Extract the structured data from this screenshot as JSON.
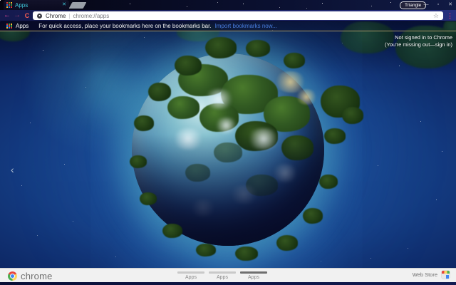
{
  "theme": {
    "accent_pink": "#ff4fa3",
    "gold_line": "#a89968",
    "toolbar_bg": "#1d2468",
    "frame_bg": "#0a0f2e",
    "link_blue": "#4a7fe0"
  },
  "tab_strip": {
    "tab": {
      "label": "Apps"
    },
    "profile_button_label": "Triangle"
  },
  "toolbar": {
    "omnibox": {
      "site_name": "Chrome",
      "separator": "|",
      "url": "chrome://apps"
    }
  },
  "bookmarks_bar": {
    "apps_label": "Apps",
    "message": "For quick access, place your bookmarks here on the bookmarks bar.",
    "import_link": "Import bookmarks now..."
  },
  "content": {
    "signin_line1": "Not signed in to Chrome",
    "signin_line2": "(You're missing out—sign in)"
  },
  "bottom_bar": {
    "brand": "chrome",
    "page_indicators": [
      {
        "label": "Apps",
        "active": false
      },
      {
        "label": "Apps",
        "active": false
      },
      {
        "label": "Apps",
        "active": true
      }
    ],
    "web_store_label": "Web Store"
  },
  "icons": {
    "back": "←",
    "forward": "→",
    "reload": "C",
    "star": "☆",
    "minimize": "—",
    "maximize": "▫",
    "close": "✕",
    "tab_close": "✕",
    "menu_dots": "⋮",
    "chevron_left": "‹"
  }
}
